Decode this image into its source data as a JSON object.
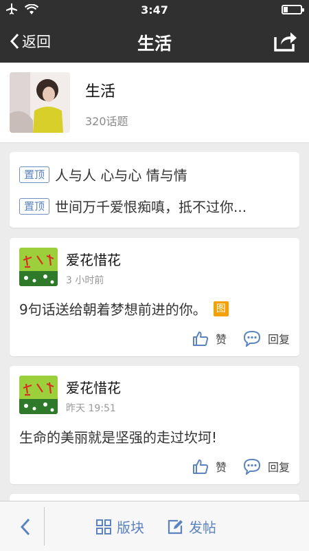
{
  "status_bar": {
    "time": "3:47"
  },
  "nav": {
    "back_label": "返回",
    "title": "生活"
  },
  "forum": {
    "name": "生活",
    "topic_count": "320话题"
  },
  "pinned": [
    {
      "tag": "置顶",
      "text": "人与人 心与心 情与情"
    },
    {
      "tag": "置顶",
      "text": "世间万千爱恨痴嗔，抵不过你..."
    }
  ],
  "posts": [
    {
      "author": "爱花惜花",
      "time": "3 小时前",
      "content": "9句话送给朝着梦想前进的你。",
      "badge": "图",
      "like_label": "赞",
      "reply_label": "回复"
    },
    {
      "author": "爱花惜花",
      "time": "昨天 19:51",
      "content": "生命的美丽就是坚强的走过坎坷!",
      "like_label": "赞",
      "reply_label": "回复"
    }
  ],
  "bottom_bar": {
    "board_label": "版块",
    "post_label": "发帖"
  },
  "colors": {
    "nav_bg": "#303030",
    "accent": "#5a83bf",
    "badge": "#f5a000",
    "bg": "#ececec"
  }
}
